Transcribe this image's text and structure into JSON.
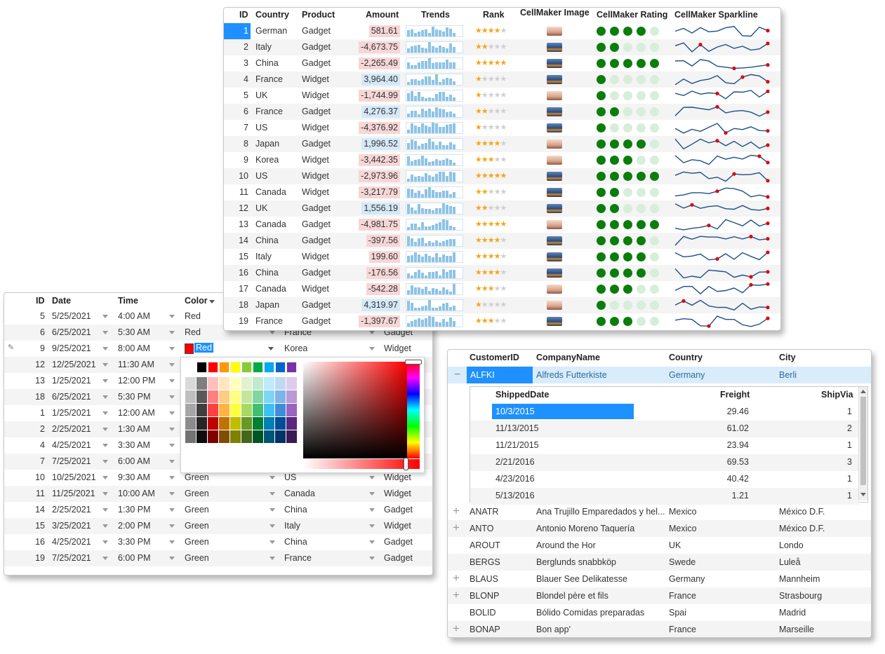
{
  "grid1": {
    "headers": {
      "id": "ID",
      "country": "Country",
      "product": "Product",
      "amount": "Amount",
      "trends": "Trends",
      "rank": "Rank",
      "image": "CellMaker Image",
      "rating": "CellMaker Rating",
      "sparkline": "CellMaker Sparkline"
    },
    "rows": [
      {
        "id": "1",
        "country": "German",
        "product": "Gadget",
        "amount": "581.61",
        "sign": "neg",
        "rank": 4,
        "image": "sunset",
        "rating": 4
      },
      {
        "id": "2",
        "country": "Italy",
        "product": "Gadget",
        "amount": "-4,673.75",
        "sign": "neg",
        "rank": 2,
        "image": "city",
        "rating": 2
      },
      {
        "id": "3",
        "country": "China",
        "product": "Gadget",
        "amount": "-2,265.49",
        "sign": "neg",
        "rank": 5,
        "image": "city",
        "rating": 5
      },
      {
        "id": "4",
        "country": "France",
        "product": "Widget",
        "amount": "3,964.40",
        "sign": "pos",
        "rank": 1,
        "image": "city",
        "rating": 1
      },
      {
        "id": "5",
        "country": "UK",
        "product": "Widget",
        "amount": "-1,744.99",
        "sign": "neg",
        "rank": 1,
        "image": "sunset",
        "rating": 1
      },
      {
        "id": "6",
        "country": "France",
        "product": "Gadget",
        "amount": "4,276.37",
        "sign": "pos",
        "rank": 2,
        "image": "city",
        "rating": 2
      },
      {
        "id": "7",
        "country": "US",
        "product": "Widget",
        "amount": "-4,376.92",
        "sign": "neg",
        "rank": 1,
        "image": "city",
        "rating": 1
      },
      {
        "id": "8",
        "country": "Japan",
        "product": "Gadget",
        "amount": "1,996.52",
        "sign": "pos",
        "rank": 4,
        "image": "sunset",
        "rating": 4
      },
      {
        "id": "9",
        "country": "Korea",
        "product": "Widget",
        "amount": "-3,442.35",
        "sign": "neg",
        "rank": 3,
        "image": "sunset",
        "rating": 3
      },
      {
        "id": "10",
        "country": "US",
        "product": "Widget",
        "amount": "-2,973.96",
        "sign": "neg",
        "rank": 5,
        "image": "city",
        "rating": 5
      },
      {
        "id": "11",
        "country": "Canada",
        "product": "Widget",
        "amount": "-3,217.79",
        "sign": "neg",
        "rank": 2,
        "image": "city",
        "rating": 2
      },
      {
        "id": "12",
        "country": "UK",
        "product": "Gadget",
        "amount": "1,556.19",
        "sign": "pos",
        "rank": 2,
        "image": "city",
        "rating": 2
      },
      {
        "id": "13",
        "country": "Canada",
        "product": "Gadget",
        "amount": "-4,981.75",
        "sign": "neg",
        "rank": 5,
        "image": "sunset",
        "rating": 5
      },
      {
        "id": "14",
        "country": "China",
        "product": "Gadget",
        "amount": "-397.56",
        "sign": "neg",
        "rank": 4,
        "image": "city",
        "rating": 4
      },
      {
        "id": "15",
        "country": "Italy",
        "product": "Widget",
        "amount": "199.60",
        "sign": "neg",
        "rank": 4,
        "image": "city",
        "rating": 4
      },
      {
        "id": "16",
        "country": "China",
        "product": "Gadget",
        "amount": "-176.56",
        "sign": "neg",
        "rank": 4,
        "image": "city",
        "rating": 4
      },
      {
        "id": "17",
        "country": "Canada",
        "product": "Widget",
        "amount": "-542.28",
        "sign": "neg",
        "rank": 3,
        "image": "sunset",
        "rating": 3
      },
      {
        "id": "18",
        "country": "Japan",
        "product": "Gadget",
        "amount": "4,319.97",
        "sign": "pos",
        "rank": 1,
        "image": "sunset",
        "rating": 1
      },
      {
        "id": "19",
        "country": "France",
        "product": "Gadget",
        "amount": "-1,397.67",
        "sign": "neg",
        "rank": 3,
        "image": "city",
        "rating": 3
      }
    ]
  },
  "grid2": {
    "headers": {
      "id": "ID",
      "date": "Date",
      "time": "Time",
      "color": "Color"
    },
    "rows": [
      {
        "id": "5",
        "date": "5/25/2021",
        "time": "4:00 AM",
        "color": "Red",
        "country": "",
        "product": ""
      },
      {
        "id": "6",
        "date": "6/25/2021",
        "time": "5:30 AM",
        "color": "Red",
        "country": "France",
        "product": "Gadget"
      },
      {
        "id": "9",
        "date": "9/25/2021",
        "time": "8:00 AM",
        "color": "Red",
        "country": "Korea",
        "product": "Widget",
        "editing": true
      },
      {
        "id": "12",
        "date": "12/25/2021",
        "time": "11:30 AM",
        "color": "",
        "country": "",
        "product": ""
      },
      {
        "id": "13",
        "date": "1/25/2021",
        "time": "12:00 PM",
        "color": "",
        "country": "",
        "product": ""
      },
      {
        "id": "18",
        "date": "6/25/2021",
        "time": "5:30 PM",
        "color": "",
        "country": "",
        "product": ""
      },
      {
        "id": "1",
        "date": "1/25/2021",
        "time": "12:00 AM",
        "color": "",
        "country": "",
        "product": ""
      },
      {
        "id": "2",
        "date": "2/25/2021",
        "time": "1:30 AM",
        "color": "",
        "country": "",
        "product": ""
      },
      {
        "id": "4",
        "date": "4/25/2021",
        "time": "3:30 AM",
        "color": "",
        "country": "",
        "product": ""
      },
      {
        "id": "7",
        "date": "7/25/2021",
        "time": "6:00 AM",
        "color": "",
        "country": "",
        "product": ""
      },
      {
        "id": "10",
        "date": "10/25/2021",
        "time": "9:30 AM",
        "color": "Green",
        "country": "US",
        "product": "Widget"
      },
      {
        "id": "11",
        "date": "11/25/2021",
        "time": "10:00 AM",
        "color": "Green",
        "country": "Canada",
        "product": "Widget"
      },
      {
        "id": "14",
        "date": "2/25/2021",
        "time": "1:30 PM",
        "color": "Green",
        "country": "China",
        "product": "Gadget"
      },
      {
        "id": "15",
        "date": "3/25/2021",
        "time": "2:00 PM",
        "color": "Green",
        "country": "Italy",
        "product": "Widget"
      },
      {
        "id": "16",
        "date": "4/25/2021",
        "time": "3:30 PM",
        "color": "Green",
        "country": "China",
        "product": "Gadget"
      },
      {
        "id": "19",
        "date": "7/25/2021",
        "time": "6:00 PM",
        "color": "Green",
        "country": "France",
        "product": "Gadget"
      }
    ],
    "editor_value": "Red"
  },
  "picker": {
    "top_colors": [
      "#000000",
      "#ff0000",
      "#ff9900",
      "#ffff00",
      "#88cc33",
      "#00aa44",
      "#00aaee",
      "#0066cc",
      "#7733aa"
    ],
    "accent": "#ff0000"
  },
  "grid3": {
    "headers": {
      "customer_id": "CustomerID",
      "company": "CompanyName",
      "country": "Country",
      "city": "City"
    },
    "expanded": {
      "id": "ALFKI",
      "company": "Alfreds Futterkiste",
      "country": "Germany",
      "city": "Berli"
    },
    "detail_headers": {
      "shipped": "ShippedDate",
      "freight": "Freight",
      "shipvia": "ShipVia"
    },
    "detail_rows": [
      {
        "shipped": "10/3/2015",
        "freight": "29.46",
        "shipvia": "1"
      },
      {
        "shipped": "11/13/2015",
        "freight": "61.02",
        "shipvia": "2"
      },
      {
        "shipped": "11/21/2015",
        "freight": "23.94",
        "shipvia": "1"
      },
      {
        "shipped": "2/21/2016",
        "freight": "69.53",
        "shipvia": "3"
      },
      {
        "shipped": "4/23/2016",
        "freight": "40.42",
        "shipvia": "1"
      },
      {
        "shipped": "5/13/2016",
        "freight": "1.21",
        "shipvia": "1"
      }
    ],
    "rows": [
      {
        "id": "ANATR",
        "company": "Ana Trujillo Emparedados y hel...",
        "country": "Mexico",
        "city": "México D.F.",
        "expander": true
      },
      {
        "id": "ANTO",
        "company": "Antonio Moreno Taquería",
        "country": "Mexico",
        "city": "México D.F.",
        "expander": true
      },
      {
        "id": "AROUT",
        "company": "Around the Hor",
        "country": "UK",
        "city": "Londo",
        "expander": false
      },
      {
        "id": "BERGS",
        "company": "Berglunds snabbköp",
        "country": "Swede",
        "city": "Luleå",
        "expander": false
      },
      {
        "id": "BLAUS",
        "company": "Blauer See Delikatesse",
        "country": "Germany",
        "city": "Mannheim",
        "expander": true
      },
      {
        "id": "BLONP",
        "company": "Blondel père et fils",
        "country": "France",
        "city": "Strasbourg",
        "expander": true
      },
      {
        "id": "BOLID",
        "company": "Bólido Comidas preparadas",
        "country": "Spai",
        "city": "Madrid",
        "expander": false
      },
      {
        "id": "BONAP",
        "company": "Bon app'",
        "country": "France",
        "city": "Marseille",
        "expander": true
      }
    ]
  }
}
